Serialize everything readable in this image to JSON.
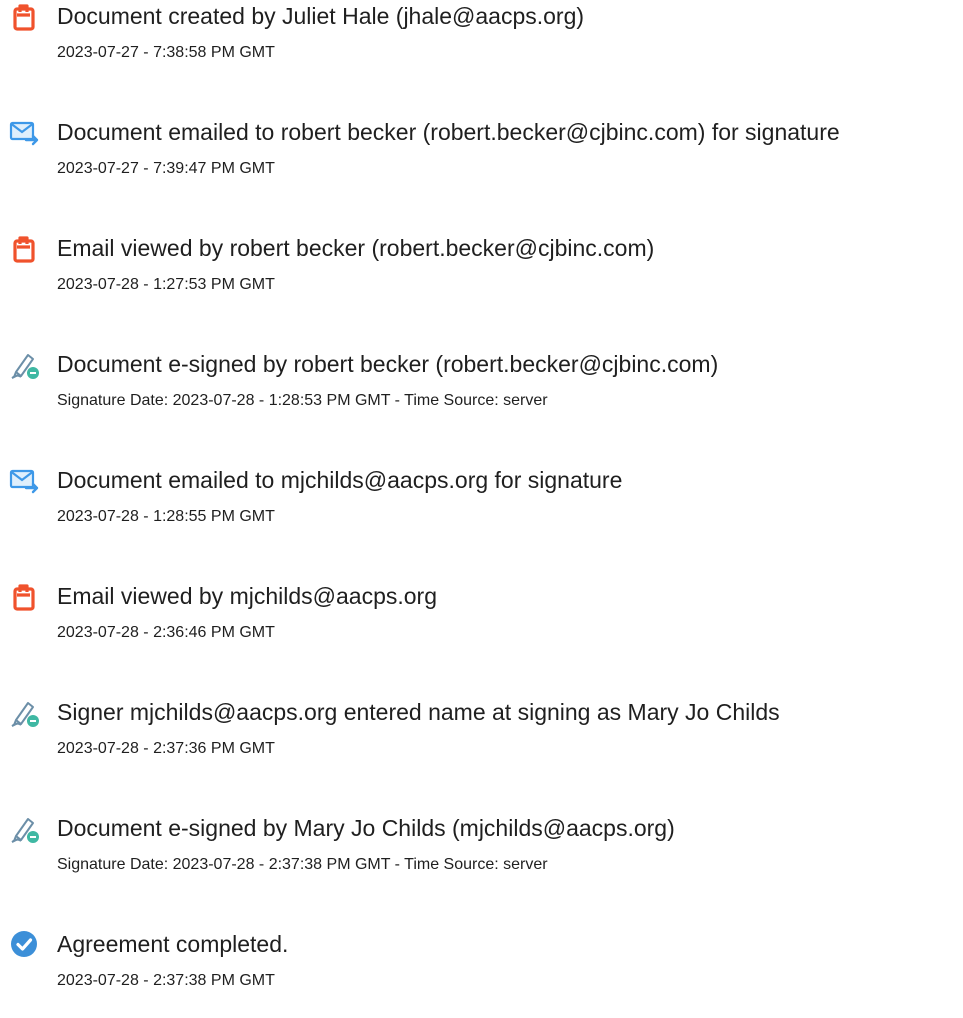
{
  "events": [
    {
      "icon": "document-icon",
      "title": "Document created by Juliet Hale (jhale@aacps.org)",
      "detail": "2023-07-27 - 7:38:58 PM GMT"
    },
    {
      "icon": "email-sent-icon",
      "title": "Document emailed to robert becker (robert.becker@cjbinc.com) for signature",
      "detail": "2023-07-27 - 7:39:47 PM GMT"
    },
    {
      "icon": "document-icon",
      "title": "Email viewed by robert becker (robert.becker@cjbinc.com)",
      "detail": "2023-07-28 - 1:27:53 PM GMT"
    },
    {
      "icon": "e-sign-icon",
      "title": "Document e-signed by robert becker (robert.becker@cjbinc.com)",
      "detail": "Signature Date: 2023-07-28 - 1:28:53 PM GMT - Time Source: server"
    },
    {
      "icon": "email-sent-icon",
      "title": "Document emailed to mjchilds@aacps.org for signature",
      "detail": "2023-07-28 - 1:28:55 PM GMT"
    },
    {
      "icon": "document-icon",
      "title": "Email viewed by mjchilds@aacps.org",
      "detail": "2023-07-28 - 2:36:46 PM GMT"
    },
    {
      "icon": "e-sign-icon",
      "title": "Signer mjchilds@aacps.org entered name at signing as Mary Jo Childs",
      "detail": "2023-07-28 - 2:37:36 PM GMT"
    },
    {
      "icon": "e-sign-icon",
      "title": "Document e-signed by Mary Jo Childs (mjchilds@aacps.org)",
      "detail": "Signature Date: 2023-07-28 - 2:37:38 PM GMT - Time Source: server"
    },
    {
      "icon": "check-circle-icon",
      "title": "Agreement completed.",
      "detail": "2023-07-28 - 2:37:38 PM GMT"
    }
  ],
  "colors": {
    "document_icon": "#f0522c",
    "email_icon": "#3d98e8",
    "sign_pen": "#6c8fa8",
    "sign_badge": "#3fb8a3",
    "check_circle": "#3c8fd8"
  }
}
